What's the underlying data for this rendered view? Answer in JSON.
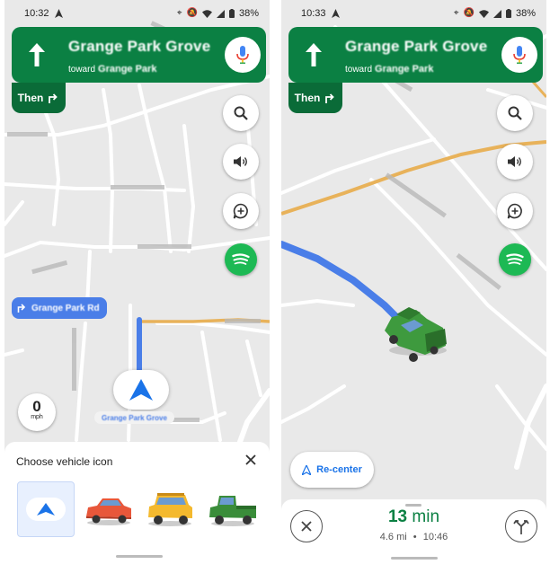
{
  "left": {
    "status": {
      "time": "10:32",
      "battery": "38%"
    },
    "nav": {
      "street": "Grange Park Grove",
      "toward_prefix": "toward",
      "toward_name": "Grange Park"
    },
    "then_label": "Then",
    "next_street": "Grange Park Rd",
    "current_street": "Grange Park Grove",
    "speed": {
      "value": "0",
      "unit": "mph"
    },
    "vehicle_sheet": {
      "title": "Choose vehicle icon",
      "options": [
        "arrow",
        "red-car",
        "yellow-suv",
        "green-pickup"
      ],
      "selected": "arrow"
    }
  },
  "right": {
    "status": {
      "time": "10:33",
      "battery": "38%"
    },
    "nav": {
      "street": "Grange Park Grove",
      "toward_prefix": "toward",
      "toward_name": "Grange Park"
    },
    "then_label": "Then",
    "recenter_label": "Re-center",
    "trip": {
      "eta_value": "13",
      "eta_unit": "min",
      "distance": "4.6 mi",
      "separator": "•",
      "arrival": "10:46"
    }
  },
  "colors": {
    "nav_green": "#0b8043",
    "then_green": "#0a6b38",
    "route_blue": "#4a7ee8",
    "major_road": "#e8b25a",
    "spotify_green": "#1db954",
    "accent_blue": "#1a73e8"
  }
}
